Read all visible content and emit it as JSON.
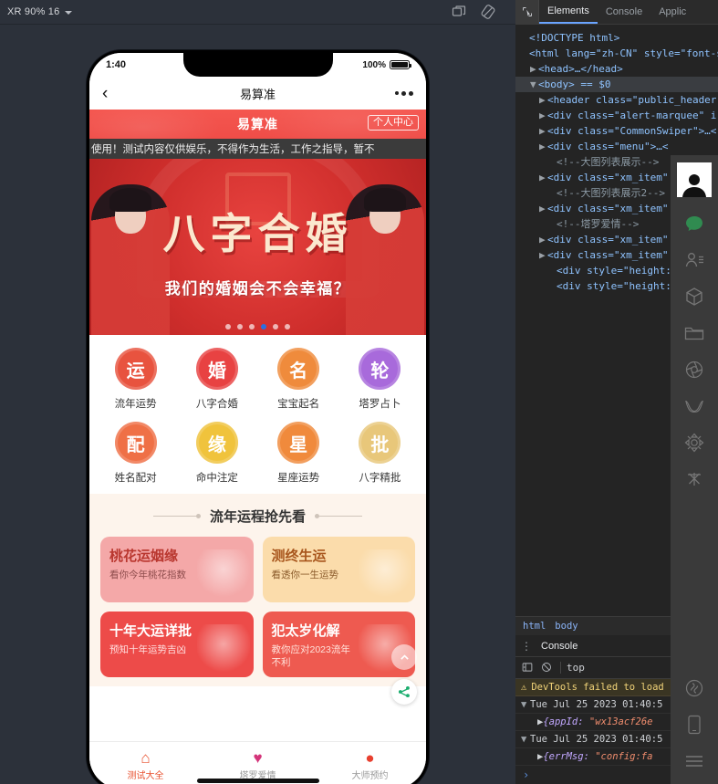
{
  "simulator": {
    "toolbar": {
      "device_label": "XR 90% 16",
      "icons": [
        "copy-screenshot-icon",
        "rotate-device-icon"
      ]
    },
    "phone": {
      "status_bar": {
        "time": "1:40",
        "battery_percent": "100%"
      },
      "nav_bar": {
        "back_icon": "chevron-left-icon",
        "title": "易算准",
        "more_icon": "more-dots-icon"
      },
      "page_header": {
        "title": "易算准",
        "user_center_button": "个人中心"
      },
      "marquee": "使用！测试内容仅供娱乐，不得作为生活，工作之指导，暂不",
      "banner": {
        "title": "八字合婚",
        "subtitle": "我们的婚姻会不会幸福？",
        "dots_count": 6,
        "active_dot": 3
      },
      "menu": [
        {
          "label": "流年运势",
          "glyph": "运",
          "color": "#e8533f",
          "icon": "fortune-year-icon"
        },
        {
          "label": "八字合婚",
          "glyph": "婚",
          "color": "#e84242",
          "icon": "marriage-match-icon"
        },
        {
          "label": "宝宝起名",
          "glyph": "名",
          "color": "#ef8b3c",
          "icon": "baby-name-icon"
        },
        {
          "label": "塔罗占卜",
          "glyph": "轮",
          "color": "#a86adb",
          "icon": "tarot-icon"
        },
        {
          "label": "姓名配对",
          "glyph": "配",
          "color": "#ef7046",
          "icon": "name-pair-icon"
        },
        {
          "label": "命中注定",
          "glyph": "缘",
          "color": "#f0c33c",
          "icon": "destiny-icon"
        },
        {
          "label": "星座运势",
          "glyph": "星",
          "color": "#f08a3c",
          "icon": "horoscope-icon"
        },
        {
          "label": "八字精批",
          "glyph": "批",
          "color": "#e8c77a",
          "icon": "bazi-detail-icon"
        }
      ],
      "section": {
        "title": "流年运程抢先看"
      },
      "cards": [
        {
          "title": "桃花运姻缘",
          "subtitle": "看你今年桃花指数",
          "bg": "#f4a8a8",
          "title_color": "#b9372f",
          "sub_color": "#8d4c4c"
        },
        {
          "title": "测终生运",
          "subtitle": "看透你一生运势",
          "bg": "#fbdcab",
          "title_color": "#a8561d",
          "sub_color": "#8a5a2a"
        },
        {
          "title": "十年大运详批",
          "subtitle": "预知十年运势吉凶",
          "bg": "#ed4b49",
          "title_color": "#ffffff",
          "sub_color": "#ffdede"
        },
        {
          "title": "犯太岁化解",
          "subtitle": "教你应对2023流年不利",
          "bg": "#ee5a50",
          "title_color": "#ffffff",
          "sub_color": "#ffe2da"
        }
      ],
      "floating": {
        "scroll_top_icon": "chevron-up-icon",
        "share_icon": "share-icon"
      },
      "tabbar": [
        {
          "label": "测试大全",
          "icon": "home-icon",
          "color": "#e8512f",
          "active": true
        },
        {
          "label": "塔罗爱情",
          "icon": "heart-icon",
          "color": "#d4357a",
          "active": false
        },
        {
          "label": "大师预约",
          "icon": "chat-bubbles-icon",
          "color": "#e8402f",
          "active": false
        }
      ]
    }
  },
  "devtools": {
    "tabs": [
      {
        "label": "Elements",
        "active": true
      },
      {
        "label": "Console",
        "active": false
      },
      {
        "label": "Applic",
        "active": false
      }
    ],
    "cursor_icon": "inspect-cursor-icon",
    "elements": [
      {
        "indent": 0,
        "tri": "",
        "text": "<!DOCTYPE html>",
        "kind": "doctype"
      },
      {
        "indent": 0,
        "tri": "",
        "text": "<html lang=\"zh-CN\" style=\"font-s",
        "kind": "tag"
      },
      {
        "indent": 1,
        "tri": "▶",
        "text": "<head>…</head>",
        "kind": "tag"
      },
      {
        "indent": 1,
        "tri": "▼",
        "text": "<body> == $0",
        "kind": "selected"
      },
      {
        "indent": 2,
        "tri": "▶",
        "text": "<header class=\"public_header",
        "kind": "tag"
      },
      {
        "indent": 2,
        "tri": "▶",
        "text": "<div class=\"alert-marquee\" i",
        "kind": "tag"
      },
      {
        "indent": 2,
        "tri": "▶",
        "text": "<div class=\"CommonSwiper\">…<",
        "kind": "tag"
      },
      {
        "indent": 2,
        "tri": "▶",
        "text": "<div class=\"menu\">…<",
        "kind": "tag"
      },
      {
        "indent": 3,
        "tri": "",
        "text": "<!--大图列表展示-->",
        "kind": "comment"
      },
      {
        "indent": 2,
        "tri": "▶",
        "text": "<div class=\"xm_item\":",
        "kind": "tag"
      },
      {
        "indent": 3,
        "tri": "",
        "text": "<!--大图列表展示2-->",
        "kind": "comment"
      },
      {
        "indent": 2,
        "tri": "▶",
        "text": "<div class=\"xm_item\":",
        "kind": "tag"
      },
      {
        "indent": 3,
        "tri": "",
        "text": "<!--塔罗爱情-->",
        "kind": "comment"
      },
      {
        "indent": 2,
        "tri": "▶",
        "text": "<div class=\"xm_item\":",
        "kind": "tag"
      },
      {
        "indent": 2,
        "tri": "▶",
        "text": "<div class=\"xm_item\":",
        "kind": "tag"
      },
      {
        "indent": 3,
        "tri": "",
        "text": "<div style=\"height: (",
        "kind": "tag"
      },
      {
        "indent": 3,
        "tri": "",
        "text": "<div style=\"height: (",
        "kind": "tag"
      }
    ],
    "breadcrumb": [
      "html",
      "body"
    ],
    "console": {
      "drawer_label": "Console",
      "context": "top",
      "warning": "DevTools failed to load",
      "logs": [
        {
          "time": "Tue Jul 25 2023 01:40:5",
          "detail_key": "{appId:",
          "detail_value": "\"wx13acf26e"
        },
        {
          "time": "Tue Jul 25 2023 01:40:5",
          "detail_key": "{errMsg:",
          "detail_value": "\"config:fa"
        }
      ],
      "prompt": "›"
    },
    "rail_icons": [
      "user-avatar-icon",
      "wechat-bubble-icon",
      "contacts-icon",
      "cube-icon",
      "folder-icon",
      "aperture-icon",
      "ribbon-icon",
      "flower-icon",
      "asterisk-icon",
      "mini-program-icon",
      "device-icon",
      "menu-lines-icon"
    ]
  }
}
